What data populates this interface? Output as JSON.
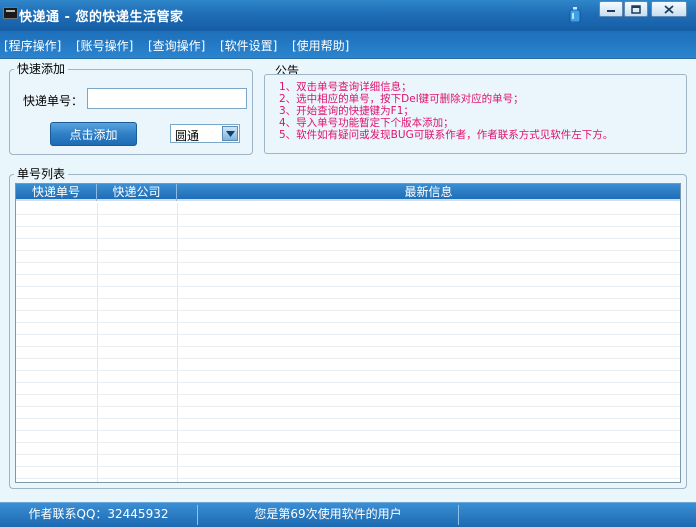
{
  "window": {
    "title": "快递通 - 您的快递生活管家"
  },
  "menu": {
    "items": [
      {
        "label": "[程序操作]"
      },
      {
        "label": "[账号操作]"
      },
      {
        "label": "[查询操作]"
      },
      {
        "label": "[软件设置]"
      },
      {
        "label": "[使用帮助]"
      }
    ]
  },
  "quick_add": {
    "title": "快速添加",
    "tracking_label": "快递单号：",
    "tracking_value": "",
    "add_button": "点击添加",
    "courier_selected": "圆通"
  },
  "notice": {
    "title": "公告",
    "lines": [
      "1、双击单号查询详细信息；",
      "2、选中相应的单号，按下Del键可删除对应的单号；",
      "3、开始查询的快捷键为F1；",
      "4、导入单号功能暂定下个版本添加；",
      "5、软件如有疑问或发现BUG可联系作者，作者联系方式见软件左下方。"
    ]
  },
  "list": {
    "title": "单号列表",
    "columns": [
      "快递单号",
      "快递公司",
      "最新信息"
    ],
    "rows": []
  },
  "status": {
    "contact": "作者联系QQ：32445932",
    "user_count": "您是第69次使用软件的用户"
  },
  "colors": {
    "accent": "#1f6db6",
    "notice_text": "#e0116f"
  }
}
